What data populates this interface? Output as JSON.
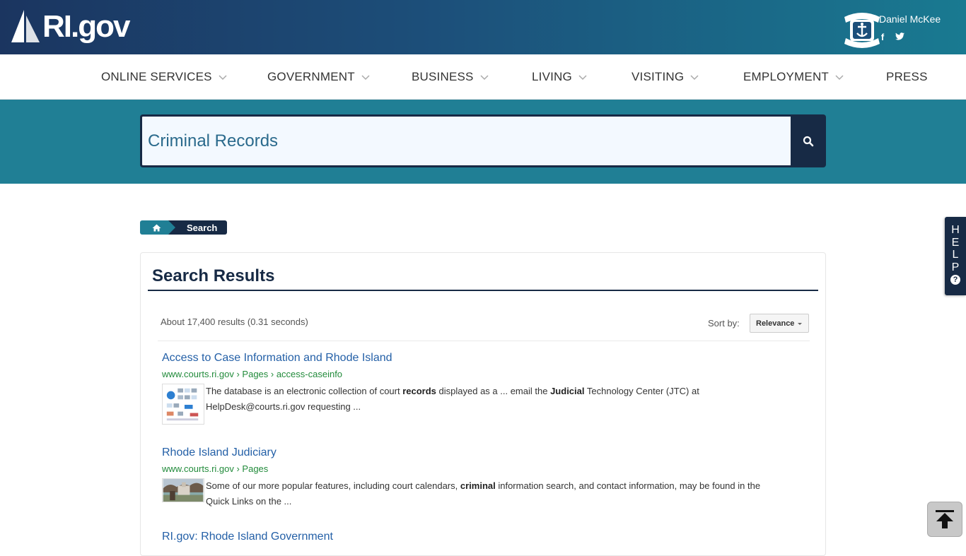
{
  "header": {
    "logo_text": "RI.gov",
    "governor": "Daniel McKee",
    "social": [
      {
        "icon": "facebook-icon",
        "glyph": "f"
      },
      {
        "icon": "twitter-icon",
        "glyph": "t"
      }
    ]
  },
  "nav": {
    "items": [
      {
        "label": "ONLINE SERVICES",
        "has_dropdown": true
      },
      {
        "label": "GOVERNMENT",
        "has_dropdown": true
      },
      {
        "label": "BUSINESS",
        "has_dropdown": true
      },
      {
        "label": "LIVING",
        "has_dropdown": true
      },
      {
        "label": "VISITING",
        "has_dropdown": true
      },
      {
        "label": "EMPLOYMENT",
        "has_dropdown": true
      },
      {
        "label": "PRESS",
        "has_dropdown": false
      }
    ]
  },
  "search": {
    "value": "Criminal Records",
    "button_icon": "search-icon"
  },
  "breadcrumb": {
    "home_icon": "home-icon",
    "current": "Search"
  },
  "help_tab": {
    "letters": [
      "H",
      "E",
      "L",
      "P"
    ],
    "icon": "question-icon"
  },
  "results": {
    "title": "Search Results",
    "count_text": "About 17,400 results (0.31 seconds)",
    "sort_label": "Sort by:",
    "sort_value": "Relevance",
    "items": [
      {
        "title": "Access to Case Information and Rhode Island",
        "url": "www.courts.ri.gov › Pages › access-caseinfo",
        "snippet_parts": [
          {
            "t": "The database is an electronic collection of court ",
            "b": false
          },
          {
            "t": "records",
            "b": true
          },
          {
            "t": " displayed as a ... email the ",
            "b": false
          },
          {
            "t": "Judicial",
            "b": true
          },
          {
            "t": " Technology Center (JTC) at HelpDesk@courts.ri.gov requesting ...",
            "b": false
          }
        ]
      },
      {
        "title": "Rhode Island Judiciary",
        "url": "www.courts.ri.gov › Pages",
        "snippet_parts": [
          {
            "t": "Some of our more popular features, including court calendars, ",
            "b": false
          },
          {
            "t": "criminal",
            "b": true
          },
          {
            "t": " information search, and contact information, may be found in the Quick Links on the ...",
            "b": false
          }
        ]
      },
      {
        "title": "RI.gov: Rhode Island Government",
        "url": "",
        "snippet_parts": []
      }
    ]
  },
  "back_to_top_icon": "arrow-up-icon",
  "colors": {
    "navy": "#172a45",
    "teal": "#207f95",
    "link": "#2460a7",
    "url_green": "#228b3b"
  }
}
